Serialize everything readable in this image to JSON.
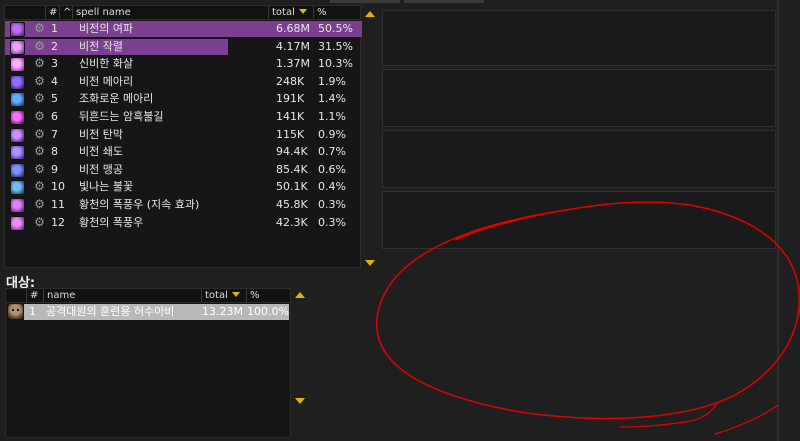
{
  "spells_table": {
    "headers": {
      "index": "#",
      "sort": "^",
      "name": "spell name",
      "total": "total",
      "pct": "%"
    },
    "rows": [
      {
        "index": "1",
        "name": "비전의 여파",
        "total": "6.68M",
        "pct": "50.5%",
        "share": 1.0,
        "icon": "arcane-purple-icon"
      },
      {
        "index": "2",
        "name": "비전 작렬",
        "total": "4.17M",
        "pct": "31.5%",
        "share": 0.624,
        "icon": "arcane-blast-icon"
      },
      {
        "index": "3",
        "name": "신비한 화살",
        "total": "1.37M",
        "pct": "10.3%",
        "share": 0.0,
        "icon": "arcane-missiles-icon"
      },
      {
        "index": "4",
        "name": "비전 메아리",
        "total": "248K",
        "pct": "1.9%",
        "share": 0.0,
        "icon": "arcane-echo-icon"
      },
      {
        "index": "5",
        "name": "조화로운 메아리",
        "total": "191K",
        "pct": "1.4%",
        "share": 0.0,
        "icon": "harmonic-echo-icon"
      },
      {
        "index": "6",
        "name": "뒤흔드는 암흑불길",
        "total": "141K",
        "pct": "1.1%",
        "share": 0.0,
        "icon": "shadowflame-icon"
      },
      {
        "index": "7",
        "name": "비전 탄막",
        "total": "115K",
        "pct": "0.9%",
        "share": 0.0,
        "icon": "arcane-barrage-icon"
      },
      {
        "index": "8",
        "name": "비전 쇄도",
        "total": "94.4K",
        "pct": "0.7%",
        "share": 0.0,
        "icon": "arcane-surge-icon"
      },
      {
        "index": "9",
        "name": "비전 맹공",
        "total": "85.4K",
        "pct": "0.6%",
        "share": 0.0,
        "icon": "arcane-assault-icon"
      },
      {
        "index": "10",
        "name": "빛나는 불꽃",
        "total": "50.1K",
        "pct": "0.4%",
        "share": 0.0,
        "icon": "radiant-spark-icon"
      },
      {
        "index": "11",
        "name": "황천의 폭풍우 (지속 효과)",
        "total": "45.8K",
        "pct": "0.3%",
        "share": 0.0,
        "icon": "nether-tempest-dot-icon"
      },
      {
        "index": "12",
        "name": "황천의 폭풍우",
        "total": "42.3K",
        "pct": "0.3%",
        "share": 0.0,
        "icon": "nether-tempest-icon"
      }
    ]
  },
  "targets": {
    "label": "대상:",
    "headers": {
      "index": "#",
      "name": "name",
      "total": "total",
      "pct": "%"
    },
    "rows": [
      {
        "index": "1",
        "name": "공격대원의 훈련용 허수아비",
        "total": "13.23M",
        "pct": "100.0%",
        "share": 1.0,
        "icon": "skull-icon"
      }
    ]
  },
  "colors": {
    "bar": "#7a3f8e",
    "accent": "#e0b400",
    "annotation": "#e00000"
  }
}
